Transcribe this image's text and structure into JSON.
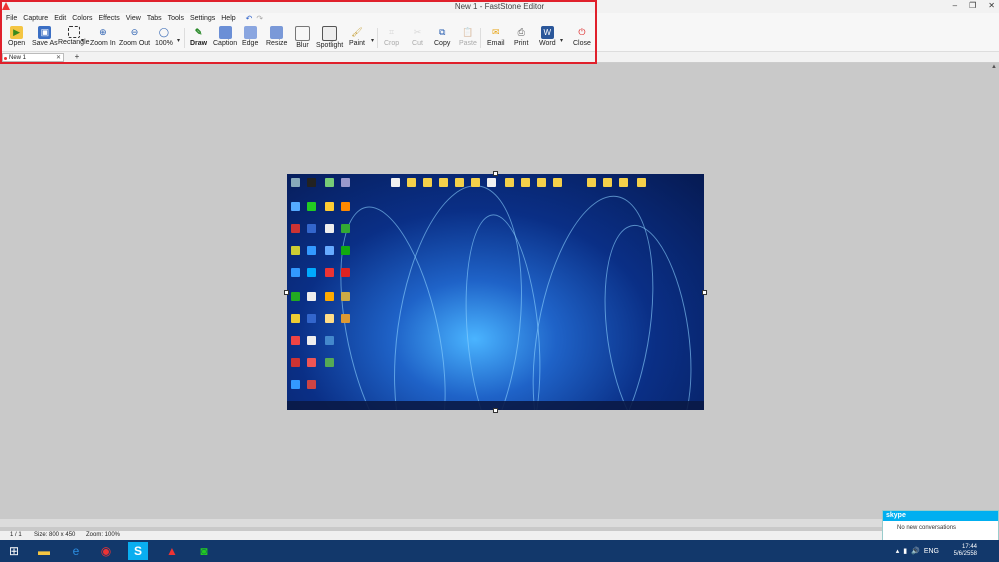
{
  "window": {
    "title": "New 1 - FastStone Editor"
  },
  "menu": [
    "File",
    "Capture",
    "Edit",
    "Colors",
    "Effects",
    "View",
    "Tabs",
    "Tools",
    "Settings",
    "Help"
  ],
  "toolbar": [
    {
      "label": "Open",
      "icon": "open-folder-icon"
    },
    {
      "label": "Save As",
      "icon": "save-icon"
    },
    {
      "label": "Rectangle",
      "icon": "rectangle-select-icon"
    },
    {
      "label": "Zoom In",
      "icon": "zoom-in-icon"
    },
    {
      "label": "Zoom Out",
      "icon": "zoom-out-icon"
    },
    {
      "label": "100%",
      "icon": "zoom-100-icon"
    },
    {
      "label": "Draw",
      "icon": "draw-icon"
    },
    {
      "label": "Caption",
      "icon": "caption-icon"
    },
    {
      "label": "Edge",
      "icon": "edge-icon"
    },
    {
      "label": "Resize",
      "icon": "resize-icon"
    },
    {
      "label": "Blur",
      "icon": "blur-icon"
    },
    {
      "label": "Spotlight",
      "icon": "spotlight-icon"
    },
    {
      "label": "Paint",
      "icon": "paint-icon"
    },
    {
      "label": "Crop",
      "icon": "crop-icon",
      "disabled": true
    },
    {
      "label": "Cut",
      "icon": "cut-icon",
      "disabled": true
    },
    {
      "label": "Copy",
      "icon": "copy-icon"
    },
    {
      "label": "Paste",
      "icon": "paste-icon",
      "disabled": true
    },
    {
      "label": "Email",
      "icon": "email-icon"
    },
    {
      "label": "Print",
      "icon": "print-icon"
    },
    {
      "label": "Word",
      "icon": "word-icon"
    },
    {
      "label": "Close",
      "icon": "close-power-icon"
    }
  ],
  "tabs": [
    {
      "label": "New 1"
    }
  ],
  "status": {
    "page": "1 / 1",
    "size": "Size: 800 x 450",
    "zoom": "Zoom: 100%"
  },
  "taskbar": {
    "time": "17:44",
    "date": "5/6/2558",
    "lang": "ENG"
  },
  "skype": {
    "brand": "skype",
    "message": "No new conversations"
  }
}
